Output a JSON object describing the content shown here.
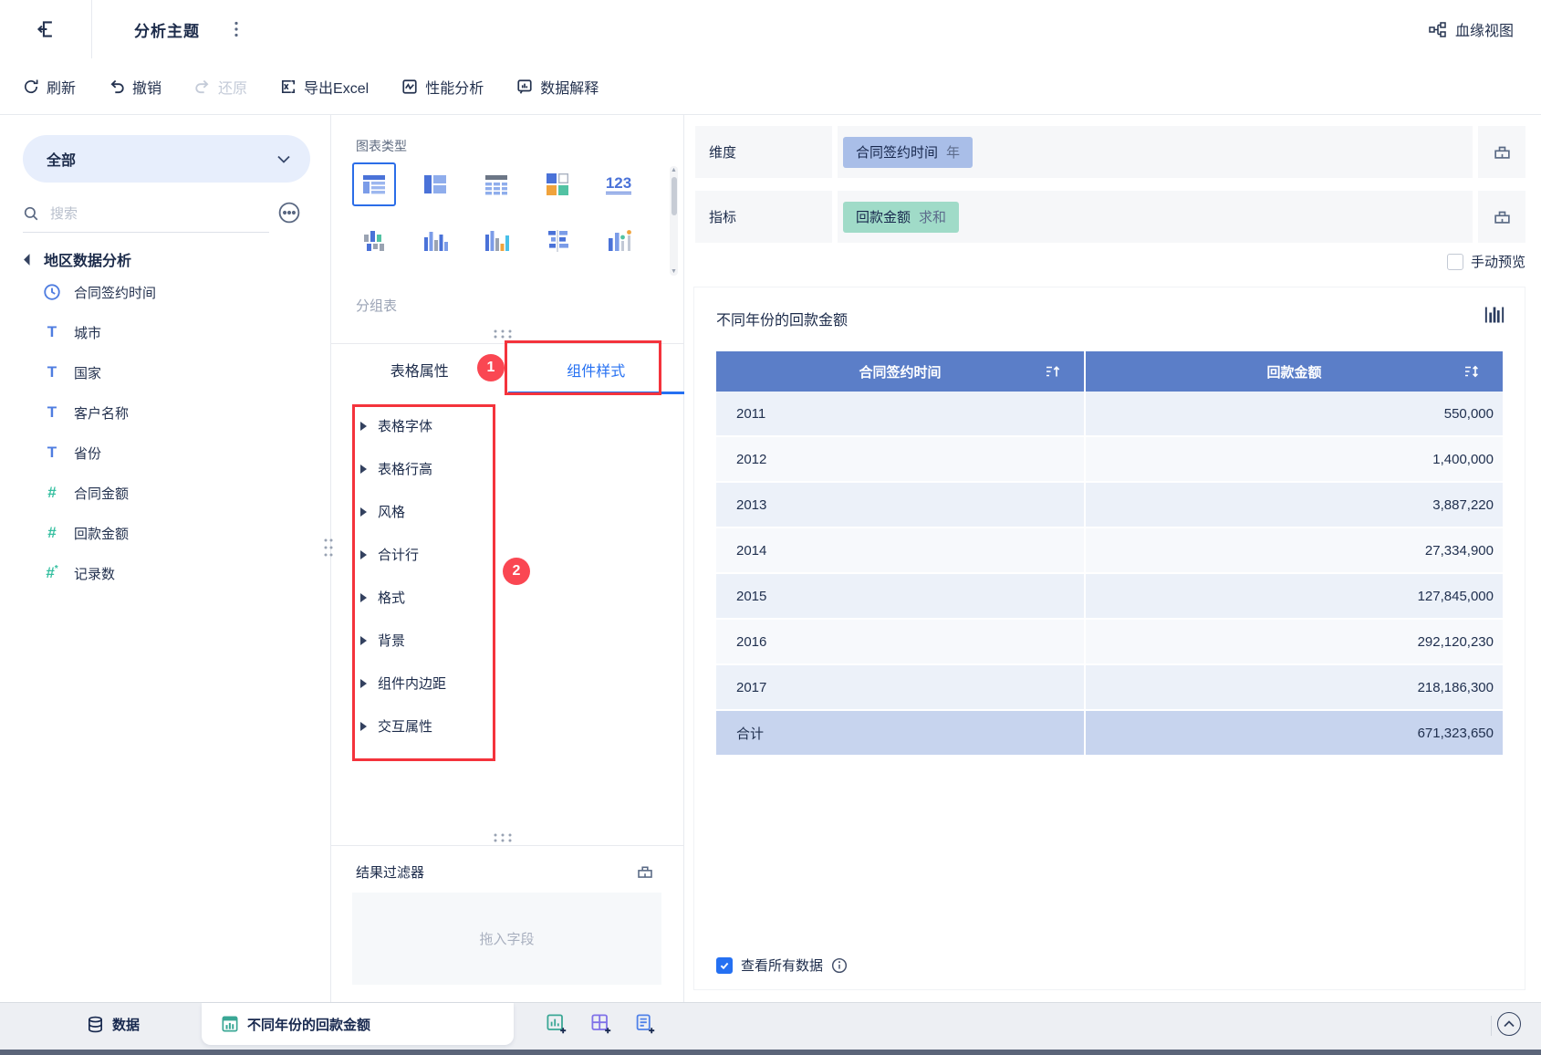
{
  "app": {
    "title": "分析主题",
    "lineage_label": "血缘视图"
  },
  "toolbar": {
    "items": [
      {
        "label": "刷新"
      },
      {
        "label": "撤销"
      },
      {
        "label": "还原"
      },
      {
        "label": "导出Excel"
      },
      {
        "label": "性能分析"
      },
      {
        "label": "数据解释"
      }
    ]
  },
  "sidebar": {
    "scope_selector": "全部",
    "search_placeholder": "搜索",
    "tree_root": "地区数据分析",
    "fields": [
      {
        "label": "合同签约时间",
        "type": "date"
      },
      {
        "label": "城市",
        "type": "text"
      },
      {
        "label": "国家",
        "type": "text"
      },
      {
        "label": "客户名称",
        "type": "text"
      },
      {
        "label": "省份",
        "type": "text"
      },
      {
        "label": "合同金额",
        "type": "number"
      },
      {
        "label": "回款金额",
        "type": "number"
      },
      {
        "label": "记录数",
        "type": "count"
      }
    ]
  },
  "chart_panel": {
    "section_title": "图表类型",
    "selected_chart_name": "分组表",
    "kpi_icon_label": "123",
    "tabs": [
      {
        "label": "表格属性"
      },
      {
        "label": "组件样式"
      }
    ],
    "style_items": [
      "表格字体",
      "表格行高",
      "风格",
      "合计行",
      "格式",
      "背景",
      "组件内边距",
      "交互属性"
    ],
    "annotation_badges": {
      "step1": "1",
      "step2": "2"
    },
    "result_filter_title": "结果过滤器",
    "drop_placeholder": "拖入字段"
  },
  "config": {
    "dimension_label": "维度",
    "dimension_pill": {
      "name": "合同签约时间",
      "modifier": "年"
    },
    "measure_label": "指标",
    "measure_pill": {
      "name": "回款金额",
      "modifier": "求和"
    },
    "manual_preview_label": "手动预览",
    "view_all_label": "查看所有数据"
  },
  "table": {
    "title": "不同年份的回款金额",
    "columns": [
      "合同签约时间",
      "回款金额"
    ],
    "rows": [
      {
        "year": "2011",
        "value": "550,000"
      },
      {
        "year": "2012",
        "value": "1,400,000"
      },
      {
        "year": "2013",
        "value": "3,887,220"
      },
      {
        "year": "2014",
        "value": "27,334,900"
      },
      {
        "year": "2015",
        "value": "127,845,000"
      },
      {
        "year": "2016",
        "value": "292,120,230"
      },
      {
        "year": "2017",
        "value": "218,186,300"
      }
    ],
    "total": {
      "label": "合计",
      "value": "671,323,650"
    }
  },
  "bottom": {
    "data_label": "数据",
    "active_sheet": "不同年份的回款金额"
  },
  "colors": {
    "accent": "#2570f2",
    "table_header": "#5b7ec8",
    "total_row": "#c7d4ee",
    "row_odd": "#ecf1f9",
    "row_even": "#f7f9fc",
    "dimension_pill": "#a9bee8",
    "measure_pill": "#a0dbc8",
    "annotation_red": "#f4333c"
  }
}
